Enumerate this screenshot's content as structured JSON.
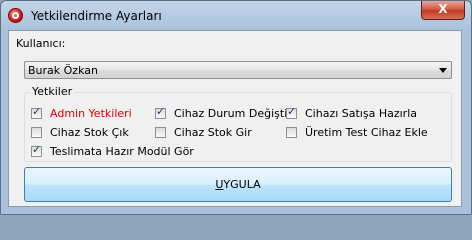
{
  "window": {
    "title": "Yetkilendirme Ayarları",
    "close_label": "X"
  },
  "user": {
    "label": "Kullanıcı:",
    "selected": "Burak Özkan"
  },
  "permissions": {
    "legend": "Yetkiler",
    "items": [
      {
        "label": "Admin Yetkileri",
        "checked": true,
        "color": "#e00000"
      },
      {
        "label": "Cihaz Durum Değiştir",
        "checked": true
      },
      {
        "label": "Cihazı Satışa Hazırla",
        "checked": true
      },
      {
        "label": "Cihaz Stok Çık",
        "checked": false
      },
      {
        "label": "Cihaz Stok Gir",
        "checked": false
      },
      {
        "label": "Üretim Test Cihaz Ekle",
        "checked": false
      },
      {
        "label": "Teslimata Hazır Modül Gör",
        "checked": true
      }
    ]
  },
  "apply": {
    "mnemonic": "U",
    "rest": "YGULA"
  }
}
